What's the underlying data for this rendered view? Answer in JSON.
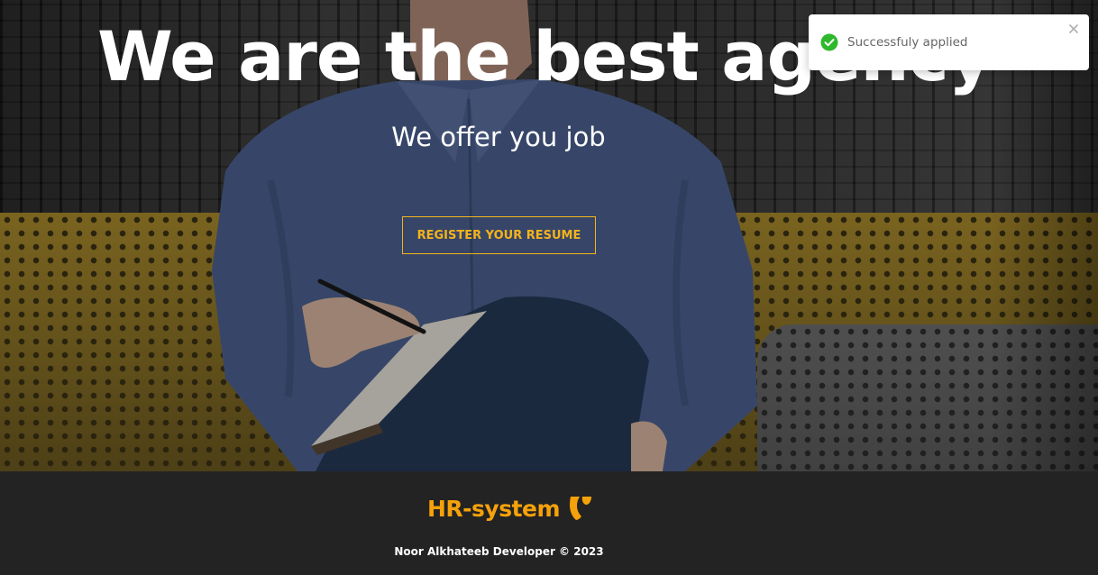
{
  "hero": {
    "title": "We are the best agency",
    "subtitle": "We offer you job",
    "cta_label": "REGISTER YOUR RESUME",
    "accent_color": "#f5b31a"
  },
  "toast": {
    "message": "Successfuly applied",
    "status": "success",
    "icon": "check-circle-icon",
    "close_icon": "close-icon",
    "status_color": "#2eb82e"
  },
  "footer": {
    "brand": "HR-system",
    "brand_logo": "typo3-logo-icon",
    "copyright": "Noor Alkhateeb Developer © 2023",
    "brand_color": "#f5a10b"
  }
}
